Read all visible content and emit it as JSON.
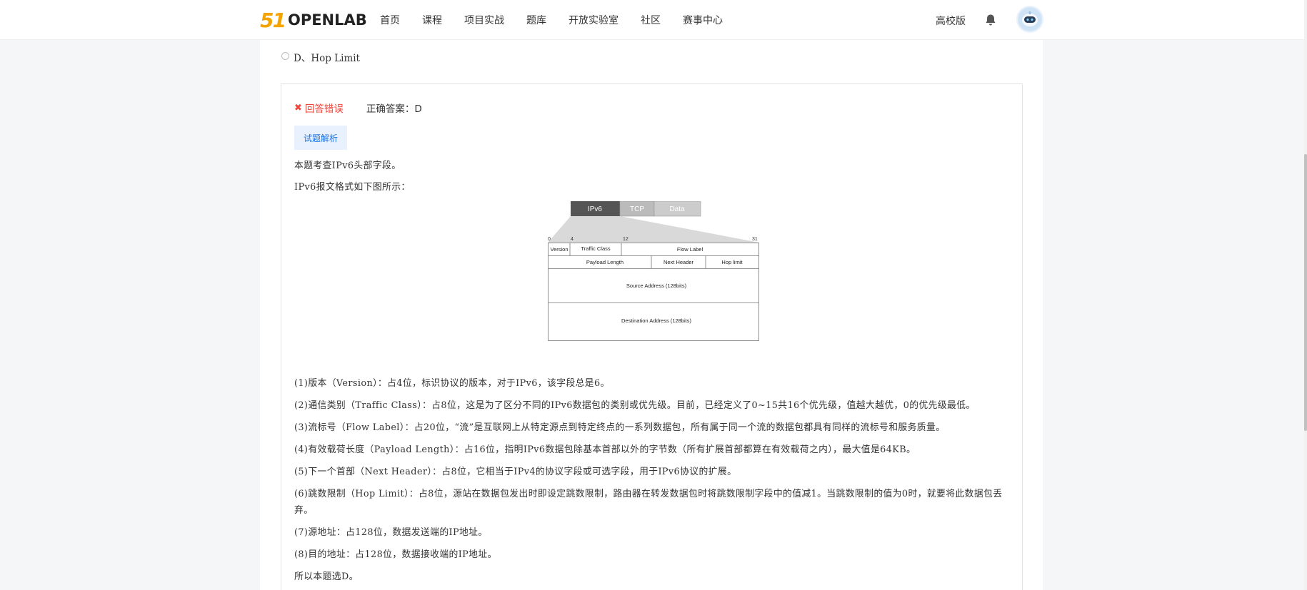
{
  "header": {
    "logo_num": "51",
    "logo_text": "OPENLAB",
    "nav": [
      "首页",
      "课程",
      "项目实战",
      "题库",
      "开放实验室",
      "社区",
      "赛事中心"
    ],
    "campus_label": "高校版",
    "bell_icon": "bell-icon",
    "avatar_icon": "robot-avatar-icon"
  },
  "question": {
    "option_d": "D、Hop Limit"
  },
  "result": {
    "wrong_label": "回答错误",
    "correct_answer": "正确答案：D",
    "analysis_tab": "试题解析"
  },
  "analysis": {
    "intro": "本题考查IPv6头部字段。",
    "format_line": "IPv6报文格式如下图所示：",
    "items": [
      "(1)版本（Version）：占4位，标识协议的版本，对于IPv6，该字段总是6。",
      "(2)通信类别（Traffic Class）：占8位，这是为了区分不同的IPv6数据包的类别或优先级。目前，已经定义了0~15共16个优先级，值越大越优，0的优先级最低。",
      "(3)流标号（Flow Label）：占20位，“流”是互联网上从特定源点到特定终点的一系列数据包，所有属于同一个流的数据包都具有同样的流标号和服务质量。",
      "(4)有效载荷长度（Payload Length）：占16位，指明IPv6数据包除基本首部以外的字节数（所有扩展首部都算在有效载荷之内），最大值是64KB。",
      "(5)下一个首部（Next Header）：占8位，它相当于IPv4的协议字段或可选字段，用于IPv6协议的扩展。",
      "(6)跳数限制（Hop Limit）：占8位，源站在数据包发出时即设定跳数限制，路由器在转发数据包时将跳数限制字段中的值减1。当跳数限制的值为0时，就要将此数据包丢弃。",
      "(7)源地址：占128位，数据发送端的IP地址。",
      "(8)目的地址：占128位，数据接收端的IP地址。"
    ],
    "conclusion": "所以本题选D。"
  },
  "diagram": {
    "tabs": [
      "IPv6",
      "TCP",
      "Data"
    ],
    "bit_marks": [
      "0",
      "4",
      "12",
      "31"
    ],
    "fields": {
      "version": "Version",
      "traffic_class": "Traffic Class",
      "flow_label": "Flow Label",
      "payload_length": "Payload Length",
      "next_header": "Next Header",
      "hop_limit": "Hop limit",
      "source": "Source Address (128bits)",
      "destination": "Destination Address (128bits)"
    }
  },
  "colors": {
    "error": "#f0463c",
    "link": "#1a73e8",
    "logo_accent": "#f4a300"
  }
}
